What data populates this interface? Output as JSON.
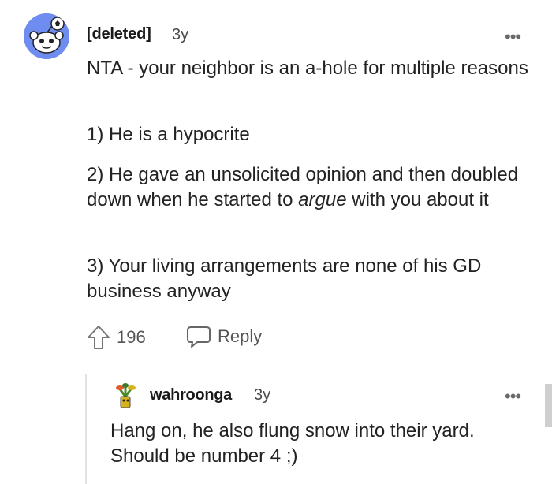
{
  "comment": {
    "username": "[deleted]",
    "age": "3y",
    "more": "•••",
    "paragraphs": {
      "p1": "NTA - your neighbor is an a-hole for multiple reasons",
      "p2": "1) He is a hypocrite",
      "p3_before": "2) He gave an unsolicited opinion and then doubled down when he started to ",
      "p3_em": "argue",
      "p3_after": " with you about it",
      "p4": "3) Your living arrangements are none of his GD business anyway"
    },
    "upvotes": "196",
    "reply_label": "Reply",
    "icons": {
      "upvote": "upvote-arrow-icon",
      "reply": "speech-bubble-icon"
    }
  },
  "reply": {
    "username": "wahroonga",
    "age": "3y",
    "more": "•••",
    "text": "Hang on, he also flung snow into their yard. Should be number 4 ;)"
  },
  "colors": {
    "avatar_bg": "#6f8df0",
    "text": "#1a1a1b",
    "muted": "#555555"
  }
}
